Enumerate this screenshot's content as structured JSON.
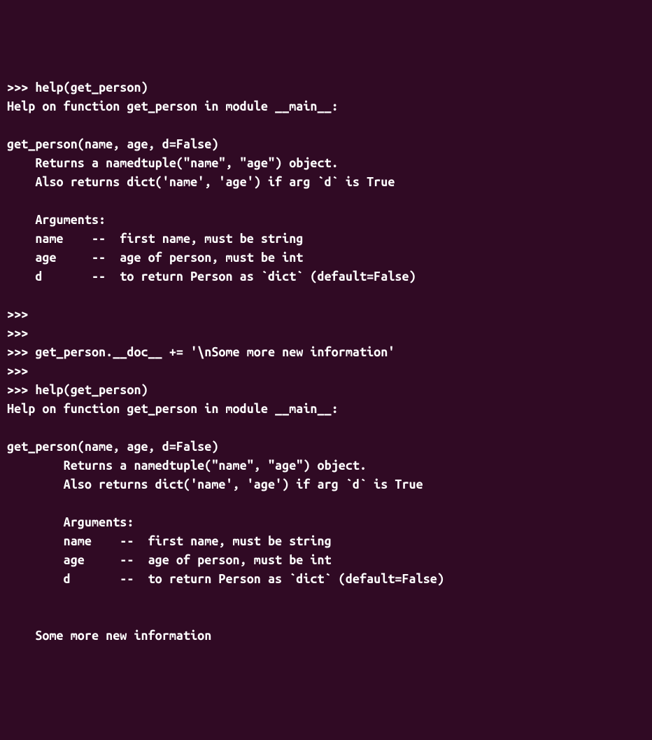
{
  "terminal": {
    "lines": [
      ">>> help(get_person)",
      "Help on function get_person in module __main__:",
      "",
      "get_person(name, age, d=False)",
      "    Returns a namedtuple(\"name\", \"age\") object.",
      "    Also returns dict('name', 'age') if arg `d` is True",
      "    ",
      "    Arguments:",
      "    name    --  first name, must be string",
      "    age     --  age of person, must be int",
      "    d       --  to return Person as `dict` (default=False)",
      "",
      ">>> ",
      ">>> ",
      ">>> get_person.__doc__ += '\\nSome more new information'",
      ">>> ",
      ">>> help(get_person)",
      "Help on function get_person in module __main__:",
      "",
      "get_person(name, age, d=False)",
      "        Returns a namedtuple(\"name\", \"age\") object.",
      "        Also returns dict('name', 'age') if arg `d` is True",
      "    ",
      "        Arguments:",
      "        name    --  first name, must be string",
      "        age     --  age of person, must be int",
      "        d       --  to return Person as `dict` (default=False)",
      "    ",
      "    ",
      "    Some more new information"
    ]
  }
}
